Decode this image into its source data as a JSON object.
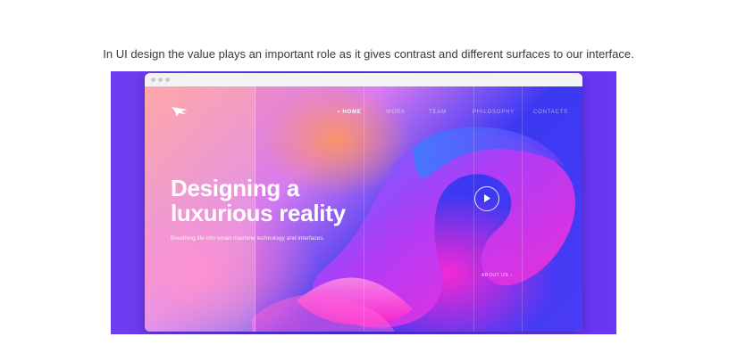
{
  "caption": "In UI design the value plays an important role as it gives contrast and different surfaces to our interface.",
  "site": {
    "nav": {
      "home": "• HOME",
      "work": "WORK",
      "team": "TEAM",
      "philosophy": "PHILOSOPHY",
      "contacts": "CONTACTS"
    },
    "headline_line1": "Designing a",
    "headline_line2": "luxurious reality",
    "subtitle": "Breathing life into smart machine technology and interfaces.",
    "about_link": "ABOUT US  ›",
    "icons": {
      "logo": "wing-logo-icon",
      "play": "play-icon"
    }
  },
  "colors": {
    "backdrop": "#4b2fe8",
    "accent_pink": "#ff28d2",
    "accent_blue": "#3b38f2",
    "peach": "#ff9aa3"
  }
}
